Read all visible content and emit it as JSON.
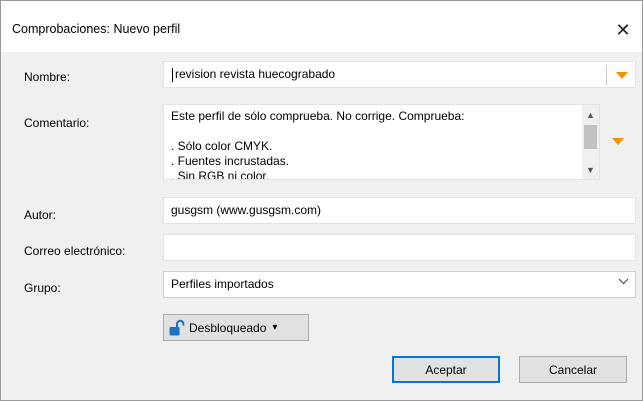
{
  "dialog": {
    "title": "Comprobaciones: Nuevo perfil",
    "close_glyph": "✕"
  },
  "form": {
    "nombre": {
      "label": "Nombre:",
      "value": "revision revista huecograbado"
    },
    "comentario": {
      "label": "Comentario:",
      "lines": [
        "Este perfil de sólo comprueba. No corrige. Comprueba:",
        "",
        ". Sólo color CMYK.",
        ". Fuentes incrustadas.",
        ". Sin RGB ni color."
      ]
    },
    "autor": {
      "label": "Autor:",
      "value": "gusgsm (www.gusgsm.com)"
    },
    "correo": {
      "label": "Correo electrónico:",
      "value": ""
    },
    "grupo": {
      "label": "Grupo:",
      "value": "Perfiles importados"
    }
  },
  "lock": {
    "label": "Desbloqueado",
    "dropdown_glyph": "▾",
    "icon": "unlocked-padlock-icon"
  },
  "buttons": {
    "accept": "Aceptar",
    "cancel": "Cancelar"
  },
  "colors": {
    "accent": "#f39200",
    "focus": "#0078d7",
    "lock_icon": "#1e73be"
  }
}
